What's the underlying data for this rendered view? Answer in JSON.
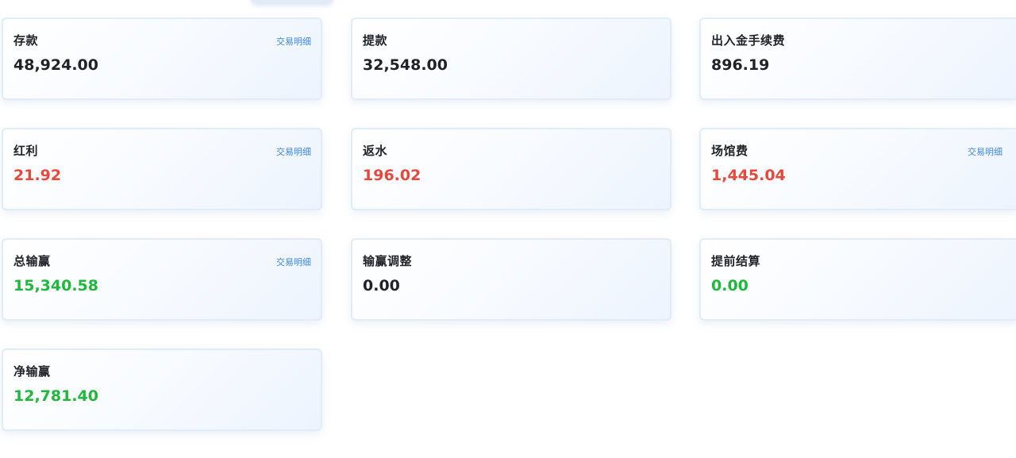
{
  "cards": [
    {
      "label": "存款",
      "value": "48,924.00",
      "link": "交易明细",
      "color": "#1f2329"
    },
    {
      "label": "提款",
      "value": "32,548.00",
      "link": "",
      "color": "#1f2329"
    },
    {
      "label": "出入金手续费",
      "value": "896.19",
      "link": "",
      "color": "#1f2329"
    },
    {
      "label": "红利",
      "value": "21.92",
      "link": "交易明细",
      "color": "#e8473b"
    },
    {
      "label": "返水",
      "value": "196.02",
      "link": "",
      "color": "#e8473b"
    },
    {
      "label": "场馆费",
      "value": "1,445.04",
      "link": "交易明细",
      "color": "#e8473b"
    },
    {
      "label": "总输赢",
      "value": "15,340.58",
      "link": "交易明细",
      "color": "#1fb83c"
    },
    {
      "label": "输赢调整",
      "value": "0.00",
      "link": "",
      "color": "#1f2329"
    },
    {
      "label": "提前结算",
      "value": "0.00",
      "link": "",
      "color": "#1fb83c"
    },
    {
      "label": "净输赢",
      "value": "12,781.40",
      "link": "",
      "color": "#1fb83c"
    }
  ]
}
